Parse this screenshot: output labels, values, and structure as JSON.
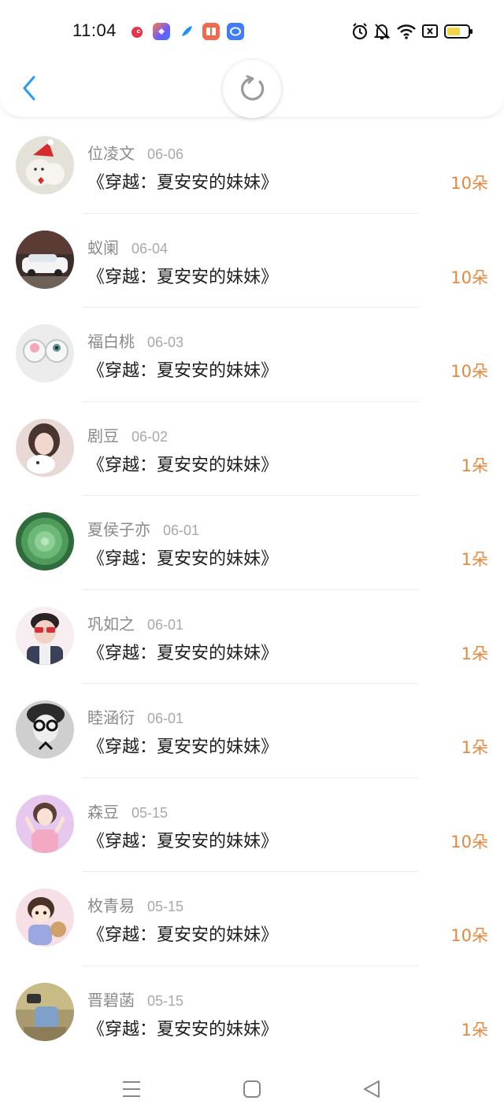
{
  "status_bar": {
    "time": "11:04",
    "app_icons": [
      {
        "name": "weibo-icon",
        "color": "#e6334a"
      },
      {
        "name": "shortcut-app-icon",
        "color": "#6a5cff"
      },
      {
        "name": "feather-app-icon",
        "color": "#1e8fff"
      },
      {
        "name": "book-app-icon",
        "color": "#f06a4d"
      },
      {
        "name": "chat-app-icon",
        "color": "#3f7cf5"
      }
    ],
    "system_icons": [
      "alarm-icon",
      "mute-icon",
      "wifi-icon",
      "sim-disabled-icon",
      "battery-icon"
    ]
  },
  "header": {
    "back_icon": "chevron-left-icon",
    "refresh_icon": "refresh-icon",
    "accent_color": "#2c9cf0"
  },
  "colors": {
    "amount": "#e5883f",
    "name": "#8a8a8a",
    "date": "#a8a8a8"
  },
  "rows": [
    {
      "name": "位凌文",
      "date": "06-06",
      "book": "《穿越：夏安安的妹妹》",
      "amount": "10朵"
    },
    {
      "name": "蚁阑",
      "date": "06-04",
      "book": "《穿越：夏安安的妹妹》",
      "amount": "10朵"
    },
    {
      "name": "福白桃",
      "date": "06-03",
      "book": "《穿越：夏安安的妹妹》",
      "amount": "10朵"
    },
    {
      "name": "剧豆",
      "date": "06-02",
      "book": "《穿越：夏安安的妹妹》",
      "amount": "1朵"
    },
    {
      "name": "夏侯子亦",
      "date": "06-01",
      "book": "《穿越：夏安安的妹妹》",
      "amount": "1朵"
    },
    {
      "name": "巩如之",
      "date": "06-01",
      "book": "《穿越：夏安安的妹妹》",
      "amount": "1朵"
    },
    {
      "name": "睦涵衍",
      "date": "06-01",
      "book": "《穿越：夏安安的妹妹》",
      "amount": "1朵"
    },
    {
      "name": "森豆",
      "date": "05-15",
      "book": "《穿越：夏安安的妹妹》",
      "amount": "10朵"
    },
    {
      "name": "枚青易",
      "date": "05-15",
      "book": "《穿越：夏安安的妹妹》",
      "amount": "10朵"
    },
    {
      "name": "晋碧菡",
      "date": "05-15",
      "book": "《穿越：夏安安的妹妹》",
      "amount": "1朵"
    }
  ],
  "nav_bar": {
    "icons": [
      "menu-icon",
      "home-square-icon",
      "back-triangle-icon"
    ]
  }
}
